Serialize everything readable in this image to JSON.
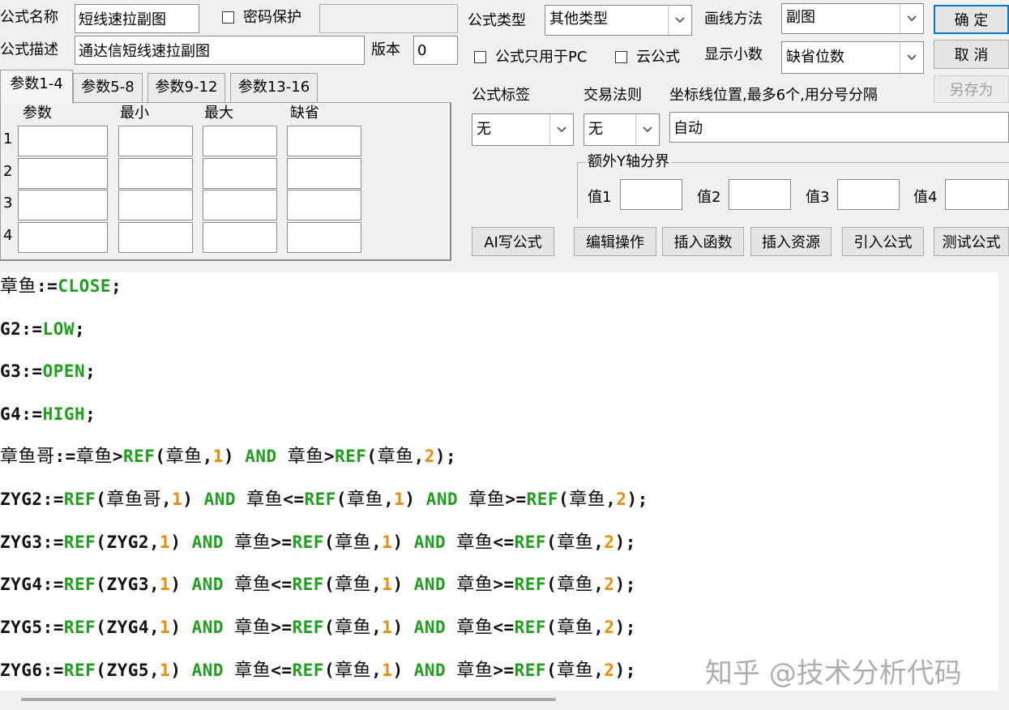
{
  "header": {
    "name_label": "公式名称",
    "name_value": "短线速拉副图",
    "password_label": "密码保护",
    "password_value": "",
    "desc_label": "公式描述",
    "desc_value": "通达信短线速拉副图",
    "version_label": "版本",
    "version_value": "0",
    "type_label": "公式类型",
    "type_value": "其他类型",
    "draw_label": "画线方法",
    "draw_value": "副图",
    "pc_only_label": "公式只用于PC",
    "cloud_label": "云公式",
    "decimals_label": "显示小数",
    "decimals_value": "缺省位数"
  },
  "buttons": {
    "ok": "确 定",
    "cancel": "取 消",
    "save_as": "另存为",
    "ai": "AI写公式",
    "edit_ops": "编辑操作",
    "insert_func": "插入函数",
    "insert_res": "插入资源",
    "import": "引入公式",
    "test": "测试公式"
  },
  "tabs": [
    "参数1-4",
    "参数5-8",
    "参数9-12",
    "参数13-16"
  ],
  "params": {
    "headers": [
      "参数",
      "最小",
      "最大",
      "缺省"
    ],
    "rows": [
      "1",
      "2",
      "3",
      "4"
    ]
  },
  "tag": {
    "label": "公式标签",
    "value": "无"
  },
  "trade": {
    "label": "交易法则",
    "value": "无"
  },
  "axis": {
    "label": "坐标线位置,最多6个,用分号分隔",
    "value": "自动"
  },
  "extra_y": {
    "title": "额外Y轴分界",
    "v1": "值1",
    "v2": "值2",
    "v3": "值3",
    "v4": "值4"
  },
  "code": [
    [
      [
        "id",
        "章鱼"
      ],
      [
        "op",
        ":="
      ],
      [
        "kw",
        "CLOSE"
      ],
      [
        "op",
        ";"
      ]
    ],
    [
      [
        "op",
        "G2:="
      ],
      [
        "kw",
        "LOW"
      ],
      [
        "op",
        ";"
      ]
    ],
    [
      [
        "op",
        "G3:="
      ],
      [
        "kw",
        "OPEN"
      ],
      [
        "op",
        ";"
      ]
    ],
    [
      [
        "op",
        "G4:="
      ],
      [
        "kw",
        "HIGH"
      ],
      [
        "op",
        ";"
      ]
    ],
    [
      [
        "id",
        "章鱼哥"
      ],
      [
        "op",
        ":="
      ],
      [
        "id",
        "章鱼"
      ],
      [
        "op",
        ">"
      ],
      [
        "kw",
        "REF"
      ],
      [
        "op",
        "("
      ],
      [
        "id",
        "章鱼"
      ],
      [
        "op",
        ","
      ],
      [
        "num",
        "1"
      ],
      [
        "op",
        ") "
      ],
      [
        "kw",
        "AND"
      ],
      [
        "op",
        " "
      ],
      [
        "id",
        "章鱼"
      ],
      [
        "op",
        ">"
      ],
      [
        "kw",
        "REF"
      ],
      [
        "op",
        "("
      ],
      [
        "id",
        "章鱼"
      ],
      [
        "op",
        ","
      ],
      [
        "num",
        "2"
      ],
      [
        "op",
        ");"
      ]
    ],
    [
      [
        "op",
        "ZYG2:="
      ],
      [
        "kw",
        "REF"
      ],
      [
        "op",
        "("
      ],
      [
        "id",
        "章鱼哥"
      ],
      [
        "op",
        ","
      ],
      [
        "num",
        "1"
      ],
      [
        "op",
        ") "
      ],
      [
        "kw",
        "AND"
      ],
      [
        "op",
        " "
      ],
      [
        "id",
        "章鱼"
      ],
      [
        "op",
        "<="
      ],
      [
        "kw",
        "REF"
      ],
      [
        "op",
        "("
      ],
      [
        "id",
        "章鱼"
      ],
      [
        "op",
        ","
      ],
      [
        "num",
        "1"
      ],
      [
        "op",
        ") "
      ],
      [
        "kw",
        "AND"
      ],
      [
        "op",
        " "
      ],
      [
        "id",
        "章鱼"
      ],
      [
        "op",
        ">="
      ],
      [
        "kw",
        "REF"
      ],
      [
        "op",
        "("
      ],
      [
        "id",
        "章鱼"
      ],
      [
        "op",
        ","
      ],
      [
        "num",
        "2"
      ],
      [
        "op",
        ");"
      ]
    ],
    [
      [
        "op",
        "ZYG3:="
      ],
      [
        "kw",
        "REF"
      ],
      [
        "op",
        "(ZYG2,"
      ],
      [
        "num",
        "1"
      ],
      [
        "op",
        ") "
      ],
      [
        "kw",
        "AND"
      ],
      [
        "op",
        " "
      ],
      [
        "id",
        "章鱼"
      ],
      [
        "op",
        ">="
      ],
      [
        "kw",
        "REF"
      ],
      [
        "op",
        "("
      ],
      [
        "id",
        "章鱼"
      ],
      [
        "op",
        ","
      ],
      [
        "num",
        "1"
      ],
      [
        "op",
        ") "
      ],
      [
        "kw",
        "AND"
      ],
      [
        "op",
        " "
      ],
      [
        "id",
        "章鱼"
      ],
      [
        "op",
        "<="
      ],
      [
        "kw",
        "REF"
      ],
      [
        "op",
        "("
      ],
      [
        "id",
        "章鱼"
      ],
      [
        "op",
        ","
      ],
      [
        "num",
        "2"
      ],
      [
        "op",
        ");"
      ]
    ],
    [
      [
        "op",
        "ZYG4:="
      ],
      [
        "kw",
        "REF"
      ],
      [
        "op",
        "(ZYG3,"
      ],
      [
        "num",
        "1"
      ],
      [
        "op",
        ") "
      ],
      [
        "kw",
        "AND"
      ],
      [
        "op",
        " "
      ],
      [
        "id",
        "章鱼"
      ],
      [
        "op",
        "<="
      ],
      [
        "kw",
        "REF"
      ],
      [
        "op",
        "("
      ],
      [
        "id",
        "章鱼"
      ],
      [
        "op",
        ","
      ],
      [
        "num",
        "1"
      ],
      [
        "op",
        ") "
      ],
      [
        "kw",
        "AND"
      ],
      [
        "op",
        " "
      ],
      [
        "id",
        "章鱼"
      ],
      [
        "op",
        ">="
      ],
      [
        "kw",
        "REF"
      ],
      [
        "op",
        "("
      ],
      [
        "id",
        "章鱼"
      ],
      [
        "op",
        ","
      ],
      [
        "num",
        "2"
      ],
      [
        "op",
        ");"
      ]
    ],
    [
      [
        "op",
        "ZYG5:="
      ],
      [
        "kw",
        "REF"
      ],
      [
        "op",
        "(ZYG4,"
      ],
      [
        "num",
        "1"
      ],
      [
        "op",
        ") "
      ],
      [
        "kw",
        "AND"
      ],
      [
        "op",
        " "
      ],
      [
        "id",
        "章鱼"
      ],
      [
        "op",
        ">="
      ],
      [
        "kw",
        "REF"
      ],
      [
        "op",
        "("
      ],
      [
        "id",
        "章鱼"
      ],
      [
        "op",
        ","
      ],
      [
        "num",
        "1"
      ],
      [
        "op",
        ") "
      ],
      [
        "kw",
        "AND"
      ],
      [
        "op",
        " "
      ],
      [
        "id",
        "章鱼"
      ],
      [
        "op",
        "<="
      ],
      [
        "kw",
        "REF"
      ],
      [
        "op",
        "("
      ],
      [
        "id",
        "章鱼"
      ],
      [
        "op",
        ","
      ],
      [
        "num",
        "2"
      ],
      [
        "op",
        ");"
      ]
    ],
    [
      [
        "op",
        "ZYG6:="
      ],
      [
        "kw",
        "REF"
      ],
      [
        "op",
        "(ZYG5,"
      ],
      [
        "num",
        "1"
      ],
      [
        "op",
        ") "
      ],
      [
        "kw",
        "AND"
      ],
      [
        "op",
        " "
      ],
      [
        "id",
        "章鱼"
      ],
      [
        "op",
        "<="
      ],
      [
        "kw",
        "REF"
      ],
      [
        "op",
        "("
      ],
      [
        "id",
        "章鱼"
      ],
      [
        "op",
        ","
      ],
      [
        "num",
        "1"
      ],
      [
        "op",
        ") "
      ],
      [
        "kw",
        "AND"
      ],
      [
        "op",
        " "
      ],
      [
        "id",
        "章鱼"
      ],
      [
        "op",
        ">="
      ],
      [
        "kw",
        "REF"
      ],
      [
        "op",
        "("
      ],
      [
        "id",
        "章鱼"
      ],
      [
        "op",
        ","
      ],
      [
        "num",
        "2"
      ],
      [
        "op",
        ");"
      ]
    ]
  ],
  "watermark": "知乎 @技术分析代码",
  "colors": {
    "keyword": "#1ea01e",
    "number": "#f08a00",
    "ok_border": "#0078d7"
  }
}
